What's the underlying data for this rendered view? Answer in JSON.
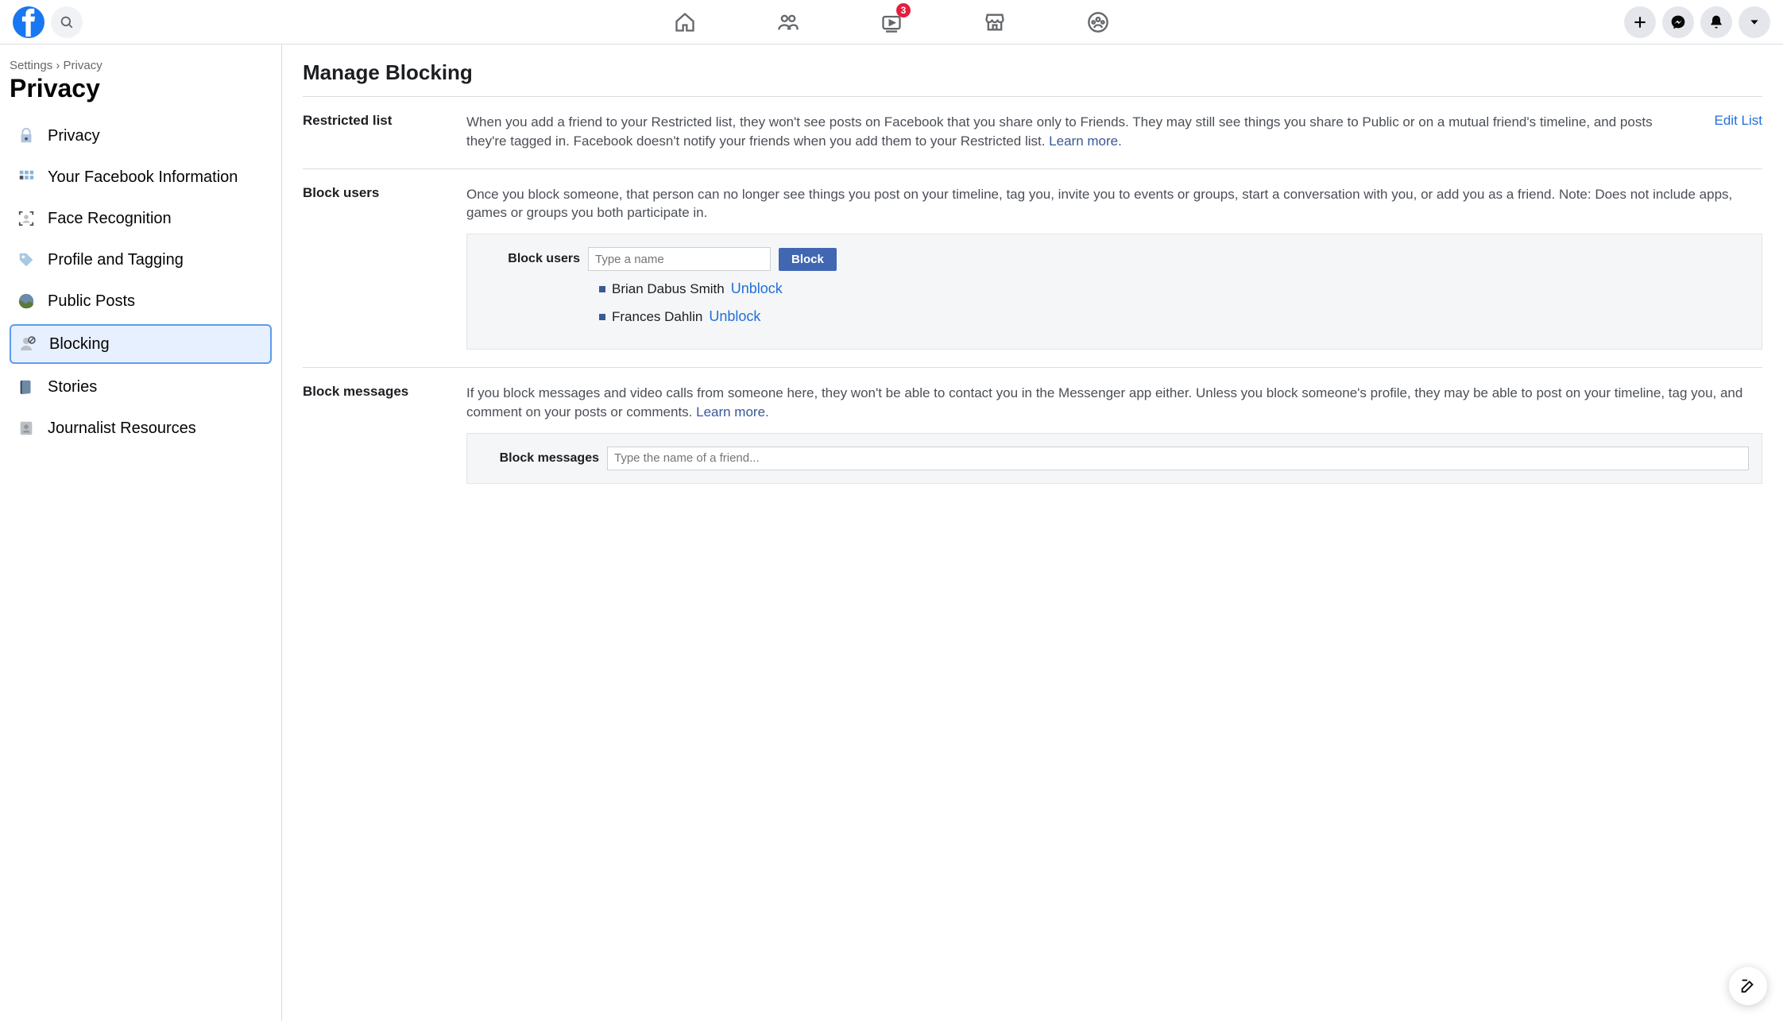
{
  "nav": {
    "watch_badge": "3"
  },
  "sidebar": {
    "breadcrumb": {
      "settings": "Settings",
      "sep": "›",
      "privacy": "Privacy"
    },
    "title": "Privacy",
    "items": [
      {
        "label": "Privacy"
      },
      {
        "label": "Your Facebook Information"
      },
      {
        "label": "Face Recognition"
      },
      {
        "label": "Profile and Tagging"
      },
      {
        "label": "Public Posts"
      },
      {
        "label": "Blocking"
      },
      {
        "label": "Stories"
      },
      {
        "label": "Journalist Resources"
      }
    ]
  },
  "main": {
    "title": "Manage Blocking",
    "restricted": {
      "title": "Restricted list",
      "desc": "When you add a friend to your Restricted list, they won't see posts on Facebook that you share only to Friends. They may still see things you share to Public or on a mutual friend's timeline, and posts they're tagged in. Facebook doesn't notify your friends when you add them to your Restricted list. ",
      "learn": "Learn more.",
      "action": "Edit List"
    },
    "block_users": {
      "title": "Block users",
      "desc": "Once you block someone, that person can no longer see things you post on your timeline, tag you, invite you to events or groups, start a conversation with you, or add you as a friend. Note: Does not include apps, games or groups you both participate in.",
      "form_label": "Block users",
      "placeholder": "Type a name",
      "button": "Block",
      "list": [
        {
          "name": "Brian Dabus Smith",
          "action": "Unblock"
        },
        {
          "name": "Frances Dahlin",
          "action": "Unblock"
        }
      ]
    },
    "block_messages": {
      "title": "Block messages",
      "desc": "If you block messages and video calls from someone here, they won't be able to contact you in the Messenger app either. Unless you block someone's profile, they may be able to post on your timeline, tag you, and comment on your posts or comments. ",
      "learn": "Learn more.",
      "form_label": "Block messages",
      "placeholder": "Type the name of a friend..."
    }
  }
}
